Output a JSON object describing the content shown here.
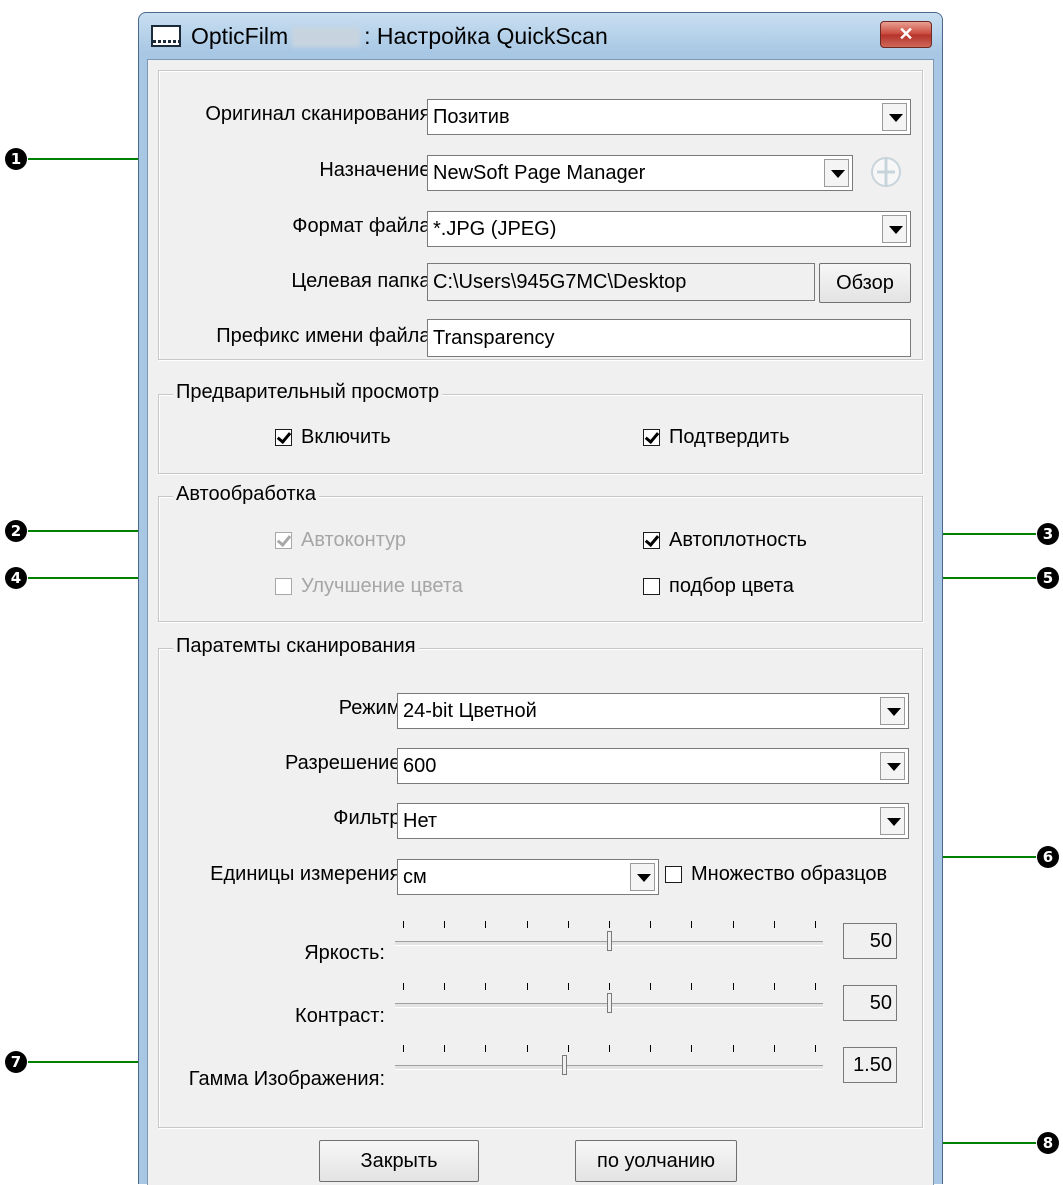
{
  "window": {
    "title_prefix": "OpticFilm",
    "title_suffix": ": Настройка QuickScan",
    "close_symbol": "✕"
  },
  "output": {
    "source_label": "Оригинал сканирования:",
    "source_value": "Позитив",
    "destination_label": "Назначение:",
    "destination_value": "NewSoft Page Manager",
    "destination_config_icon": "config-icon",
    "format_label": "Формат файла:",
    "format_value": "*.JPG (JPEG)",
    "folder_label": "Целевая папка:",
    "folder_value": "C:\\Users\\945G7MC\\Desktop",
    "browse_label": "Обзор",
    "prefix_label": "Префикс имени файла:",
    "prefix_value": "Transparency"
  },
  "preview": {
    "legend": "Предварительный просмотр",
    "enable_label": "Включить",
    "enable_checked": true,
    "confirm_label": "Подтвердить",
    "confirm_checked": true
  },
  "auto": {
    "legend": "Автообработка",
    "autocontour_label": "Автоконтур",
    "autocontour_checked": true,
    "autocontour_enabled": false,
    "autodensity_label": "Автоплотность",
    "autodensity_checked": true,
    "color_enhance_label": "Улучшение цвета",
    "color_enhance_checked": false,
    "color_enhance_enabled": false,
    "color_match_label": "подбор цвета",
    "color_match_checked": false
  },
  "scan": {
    "legend": "Паратемты сканирования",
    "mode_label": "Режим:",
    "mode_value": "24-bit Цветной",
    "resolution_label": "Разрешение:",
    "resolution_value": "600",
    "filter_label": "Фильтр:",
    "filter_value": "Нет",
    "units_label": "Единицы измерения:",
    "units_value": "см",
    "multi_label": "Множество образцов",
    "multi_checked": false,
    "brightness_label": "Яркость:",
    "brightness_value": "50",
    "brightness_fraction": 0.5,
    "contrast_label": "Контраст:",
    "contrast_value": "50",
    "contrast_fraction": 0.5,
    "gamma_label": "Гамма Изображения:",
    "gamma_value": "1.50",
    "gamma_fraction": 0.39
  },
  "buttons": {
    "close_label": "Закрыть",
    "default_label": "по уолчанию"
  },
  "callouts": [
    "1",
    "2",
    "3",
    "4",
    "5",
    "6",
    "7",
    "8"
  ],
  "colors": {
    "arrow": "#008000",
    "title_bar": "#a8c7e4",
    "close_button": "#c8463a"
  }
}
